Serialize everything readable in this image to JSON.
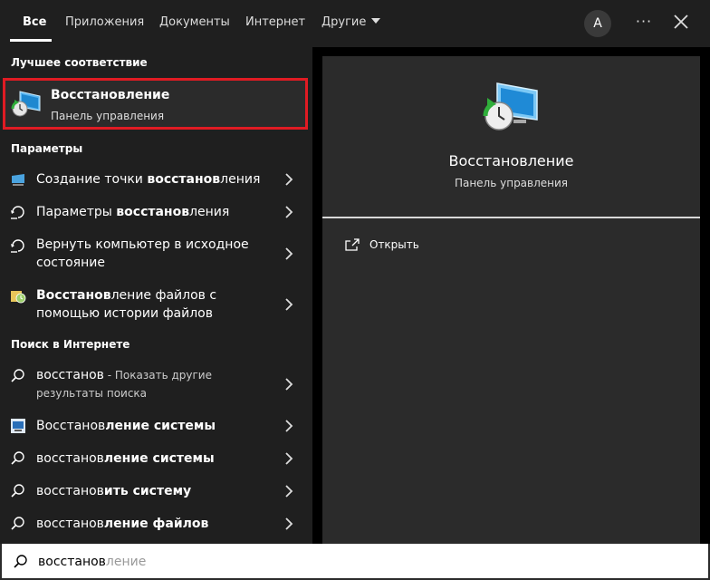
{
  "tabs": [
    "Все",
    "Приложения",
    "Документы",
    "Интернет",
    "Другие"
  ],
  "user_initial": "A",
  "best_match": {
    "header": "Лучшее соответствие",
    "title": "Восстановление",
    "subtitle": "Панель управления"
  },
  "settings": {
    "header": "Параметры",
    "items": [
      {
        "pre": "Создание точки ",
        "bold": "восстанов",
        "post": "ления"
      },
      {
        "pre": "Параметры ",
        "bold": "восстанов",
        "post": "ления"
      },
      {
        "line1": "Вернуть компьютер в исходное",
        "line2": "состояние"
      },
      {
        "bold": "Восстанов",
        "post1": "ление файлов с",
        "line2": "помощью истории файлов"
      }
    ]
  },
  "web": {
    "header": "Поиск в Интернете",
    "items": [
      {
        "term": "восстанов",
        "rest": " - Показать другие",
        "line2": "результаты поиска"
      },
      {
        "plain": "Восстанов",
        "bold": "ление системы"
      },
      {
        "plain": "восстанов",
        "bold": "ление системы"
      },
      {
        "plain": "восстанов",
        "bold": "ить систему"
      },
      {
        "plain": "восстанов",
        "bold": "ление файлов"
      }
    ]
  },
  "preview": {
    "title": "Восстановление",
    "subtitle": "Панель управления",
    "open_label": "Открыть"
  },
  "search": {
    "typed": "восстанов",
    "suggestion": "ление"
  }
}
